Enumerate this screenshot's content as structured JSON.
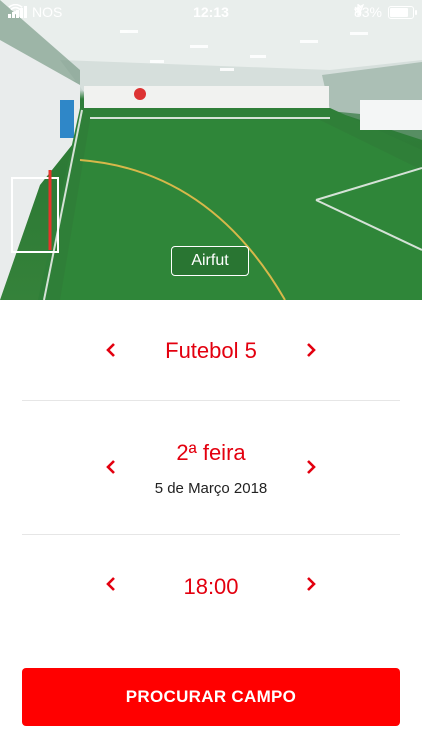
{
  "status_bar": {
    "carrier": "NOS",
    "time": "12:13",
    "battery_text": "83%",
    "icons": [
      "signal-icon",
      "wifi-icon",
      "location-icon",
      "bluetooth-icon",
      "battery-icon"
    ]
  },
  "hero": {
    "venue_name": "Airfut"
  },
  "selectors": {
    "sport": {
      "value": "Futebol 5"
    },
    "day": {
      "value": "2ª feira",
      "date": "5 de Março 2018"
    },
    "time": {
      "value": "18:00"
    }
  },
  "actions": {
    "search_label": "PROCURAR CAMPO"
  },
  "colors": {
    "accent": "#e3000f",
    "button": "#ff0000"
  }
}
